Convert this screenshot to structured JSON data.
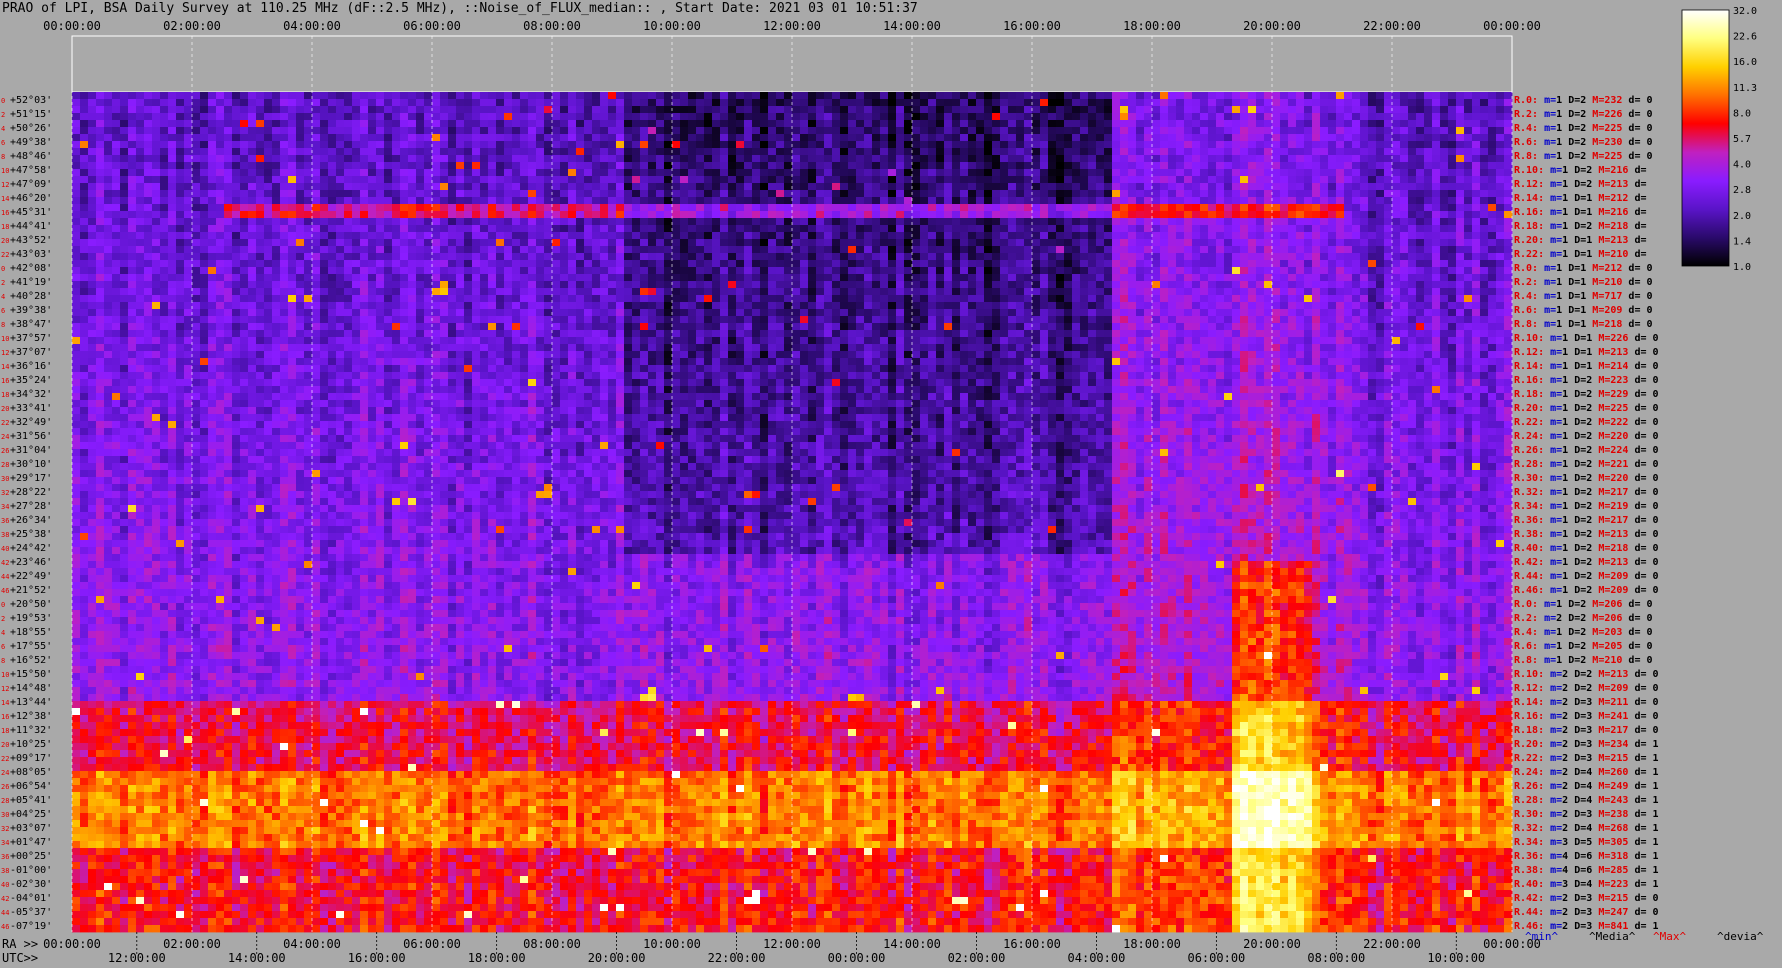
{
  "title": "PRAO of LPI, BSA Daily Survey at 110.25 MHz (dF::2.5 MHz), ::Noise_of_FLUX_median:: , Start Date: 2021 03 01 10:51:37",
  "chart_data": {
    "type": "heatmap",
    "top_time_ticks": [
      "00:00:00",
      "02:00:00",
      "04:00:00",
      "06:00:00",
      "08:00:00",
      "10:00:00",
      "12:00:00",
      "14:00:00",
      "16:00:00",
      "18:00:00",
      "20:00:00",
      "22:00:00",
      "00:00:00"
    ],
    "bottom_ra_label": "RA >>",
    "bottom_ra_ticks": [
      "00:00:00",
      "02:00:00",
      "04:00:00",
      "06:00:00",
      "08:00:00",
      "10:00:00",
      "12:00:00",
      "14:00:00",
      "16:00:00",
      "18:00:00",
      "20:00:00",
      "22:00:00",
      "00:00:00"
    ],
    "bottom_utc_label": "UTC>>",
    "bottom_utc_ticks": [
      "12:00:00",
      "14:00:00",
      "16:00:00",
      "18:00:00",
      "20:00:00",
      "22:00:00",
      "00:00:00",
      "02:00:00",
      "04:00:00",
      "06:00:00",
      "08:00:00",
      "10:00:00"
    ],
    "colorbar": {
      "ticks": [
        "32.0",
        "22.6",
        "16.0",
        "11.3",
        "8.0",
        "5.7",
        "4.0",
        "2.8",
        "2.0",
        "1.4",
        "1.0"
      ],
      "colors": [
        "#000000",
        "#2a0a6b",
        "#5a14c8",
        "#8a1cff",
        "#c020c0",
        "#ff0000",
        "#ff7000",
        "#ffd000",
        "#ffff80",
        "#ffffff"
      ]
    },
    "declinations": [
      "+52°03'",
      "+51°15'",
      "+50°26'",
      "+49°38'",
      "+48°46'",
      "+47°58'",
      "+47°09'",
      "+46°20'",
      "+45°31'",
      "+44°41'",
      "+43°52'",
      "+43°03'",
      "+42°08'",
      "+41°19'",
      "+40°28'",
      "+39°38'",
      "+38°47'",
      "+37°57'",
      "+37°07'",
      "+36°16'",
      "+35°24'",
      "+34°32'",
      "+33°41'",
      "+32°49'",
      "+31°56'",
      "+31°04'",
      "+30°10'",
      "+29°17'",
      "+28°22'",
      "+27°28'",
      "+26°34'",
      "+25°38'",
      "+24°42'",
      "+23°46'",
      "+22°49'",
      "+21°52'",
      "+20°50'",
      "+19°53'",
      "+18°55'",
      "+17°55'",
      "+16°52'",
      "+15°50'",
      "+14°48'",
      "+13°44'",
      "+12°38'",
      "+11°32'",
      "+10°25'",
      "+09°17'",
      "+08°05'",
      "+06°54'",
      "+05°41'",
      "+04°25'",
      "+03°07'",
      "+01°47'",
      "+00°25'",
      "-01°00'",
      "-02°30'",
      "-04°01'",
      "-05°37'",
      "-07°19'"
    ],
    "row_numbers": [
      "0",
      "2",
      "4",
      "6",
      "8",
      "10",
      "12",
      "14",
      "16",
      "18",
      "20",
      "22",
      "0",
      "2",
      "4",
      "6",
      "8",
      "10",
      "12",
      "14",
      "16",
      "18",
      "20",
      "22",
      "24",
      "26",
      "28",
      "30",
      "32",
      "34",
      "36",
      "38",
      "40",
      "42",
      "44",
      "46",
      "0",
      "2",
      "4",
      "6",
      "8",
      "10",
      "12",
      "14",
      "16",
      "18",
      "20",
      "22",
      "24",
      "26",
      "28",
      "30",
      "32",
      "34",
      "36",
      "38",
      "40",
      "42",
      "44",
      "46"
    ],
    "stats_rows": [
      {
        "r": "R.0:",
        "m": "1",
        "D": "2",
        "M": "232",
        "d": "0"
      },
      {
        "r": "R.2:",
        "m": "1",
        "D": "2",
        "M": "226",
        "d": "0"
      },
      {
        "r": "R.4:",
        "m": "1",
        "D": "2",
        "M": "225",
        "d": "0"
      },
      {
        "r": "R.6:",
        "m": "1",
        "D": "2",
        "M": "230",
        "d": "0"
      },
      {
        "r": "R.8:",
        "m": "1",
        "D": "2",
        "M": "225",
        "d": "0"
      },
      {
        "r": "R.10:",
        "m": "1",
        "D": "2",
        "M": "216",
        "d": ""
      },
      {
        "r": "R.12:",
        "m": "1",
        "D": "2",
        "M": "213",
        "d": ""
      },
      {
        "r": "R.14:",
        "m": "1",
        "D": "1",
        "M": "212",
        "d": ""
      },
      {
        "r": "R.16:",
        "m": "1",
        "D": "1",
        "M": "216",
        "d": ""
      },
      {
        "r": "R.18:",
        "m": "1",
        "D": "2",
        "M": "218",
        "d": ""
      },
      {
        "r": "R.20:",
        "m": "1",
        "D": "1",
        "M": "213",
        "d": ""
      },
      {
        "r": "R.22:",
        "m": "1",
        "D": "1",
        "M": "210",
        "d": ""
      },
      {
        "r": "R.0:",
        "m": "1",
        "D": "1",
        "M": "212",
        "d": "0"
      },
      {
        "r": "R.2:",
        "m": "1",
        "D": "1",
        "M": "210",
        "d": "0"
      },
      {
        "r": "R.4:",
        "m": "1",
        "D": "1",
        "M": "717",
        "d": "0"
      },
      {
        "r": "R.6:",
        "m": "1",
        "D": "1",
        "M": "209",
        "d": "0"
      },
      {
        "r": "R.8:",
        "m": "1",
        "D": "1",
        "M": "218",
        "d": "0"
      },
      {
        "r": "R.10:",
        "m": "1",
        "D": "1",
        "M": "226",
        "d": "0"
      },
      {
        "r": "R.12:",
        "m": "1",
        "D": "1",
        "M": "213",
        "d": "0"
      },
      {
        "r": "R.14:",
        "m": "1",
        "D": "1",
        "M": "214",
        "d": "0"
      },
      {
        "r": "R.16:",
        "m": "1",
        "D": "2",
        "M": "223",
        "d": "0"
      },
      {
        "r": "R.18:",
        "m": "1",
        "D": "2",
        "M": "229",
        "d": "0"
      },
      {
        "r": "R.20:",
        "m": "1",
        "D": "2",
        "M": "225",
        "d": "0"
      },
      {
        "r": "R.22:",
        "m": "1",
        "D": "2",
        "M": "222",
        "d": "0"
      },
      {
        "r": "R.24:",
        "m": "1",
        "D": "2",
        "M": "220",
        "d": "0"
      },
      {
        "r": "R.26:",
        "m": "1",
        "D": "2",
        "M": "224",
        "d": "0"
      },
      {
        "r": "R.28:",
        "m": "1",
        "D": "2",
        "M": "221",
        "d": "0"
      },
      {
        "r": "R.30:",
        "m": "1",
        "D": "2",
        "M": "220",
        "d": "0"
      },
      {
        "r": "R.32:",
        "m": "1",
        "D": "2",
        "M": "217",
        "d": "0"
      },
      {
        "r": "R.34:",
        "m": "1",
        "D": "2",
        "M": "219",
        "d": "0"
      },
      {
        "r": "R.36:",
        "m": "1",
        "D": "2",
        "M": "217",
        "d": "0"
      },
      {
        "r": "R.38:",
        "m": "1",
        "D": "2",
        "M": "213",
        "d": "0"
      },
      {
        "r": "R.40:",
        "m": "1",
        "D": "2",
        "M": "218",
        "d": "0"
      },
      {
        "r": "R.42:",
        "m": "1",
        "D": "2",
        "M": "213",
        "d": "0"
      },
      {
        "r": "R.44:",
        "m": "1",
        "D": "2",
        "M": "209",
        "d": "0"
      },
      {
        "r": "R.46:",
        "m": "1",
        "D": "2",
        "M": "209",
        "d": "0"
      },
      {
        "r": "R.0:",
        "m": "1",
        "D": "2",
        "M": "206",
        "d": "0"
      },
      {
        "r": "R.2:",
        "m": "2",
        "D": "2",
        "M": "206",
        "d": "0"
      },
      {
        "r": "R.4:",
        "m": "1",
        "D": "2",
        "M": "203",
        "d": "0"
      },
      {
        "r": "R.6:",
        "m": "1",
        "D": "2",
        "M": "205",
        "d": "0"
      },
      {
        "r": "R.8:",
        "m": "1",
        "D": "2",
        "M": "210",
        "d": "0"
      },
      {
        "r": "R.10:",
        "m": "2",
        "D": "2",
        "M": "213",
        "d": "0"
      },
      {
        "r": "R.12:",
        "m": "2",
        "D": "2",
        "M": "209",
        "d": "0"
      },
      {
        "r": "R.14:",
        "m": "2",
        "D": "3",
        "M": "211",
        "d": "0"
      },
      {
        "r": "R.16:",
        "m": "2",
        "D": "3",
        "M": "241",
        "d": "0"
      },
      {
        "r": "R.18:",
        "m": "2",
        "D": "3",
        "M": "217",
        "d": "0"
      },
      {
        "r": "R.20:",
        "m": "2",
        "D": "3",
        "M": "234",
        "d": "1"
      },
      {
        "r": "R.22:",
        "m": "2",
        "D": "3",
        "M": "215",
        "d": "1"
      },
      {
        "r": "R.24:",
        "m": "2",
        "D": "4",
        "M": "260",
        "d": "1"
      },
      {
        "r": "R.26:",
        "m": "2",
        "D": "4",
        "M": "249",
        "d": "1"
      },
      {
        "r": "R.28:",
        "m": "2",
        "D": "4",
        "M": "243",
        "d": "1"
      },
      {
        "r": "R.30:",
        "m": "2",
        "D": "3",
        "M": "238",
        "d": "1"
      },
      {
        "r": "R.32:",
        "m": "2",
        "D": "4",
        "M": "268",
        "d": "1"
      },
      {
        "r": "R.34:",
        "m": "3",
        "D": "5",
        "M": "305",
        "d": "1"
      },
      {
        "r": "R.36:",
        "m": "4",
        "D": "6",
        "M": "318",
        "d": "1"
      },
      {
        "r": "R.38:",
        "m": "4",
        "D": "6",
        "M": "285",
        "d": "1"
      },
      {
        "r": "R.40:",
        "m": "3",
        "D": "4",
        "M": "223",
        "d": "1"
      },
      {
        "r": "R.42:",
        "m": "2",
        "D": "3",
        "M": "215",
        "d": "0"
      },
      {
        "r": "R.44:",
        "m": "2",
        "D": "3",
        "M": "247",
        "d": "0"
      },
      {
        "r": "R.46:",
        "m": "2",
        "D": "3",
        "M": "841",
        "d": "1"
      }
    ],
    "stats_legend": [
      "^min^",
      "^Media^",
      "^Max^",
      "^devia^"
    ],
    "colors": {
      "background": "#a9a9a9",
      "label_red": "#e00000",
      "label_blue": "#0000cc",
      "text": "#000000"
    }
  }
}
